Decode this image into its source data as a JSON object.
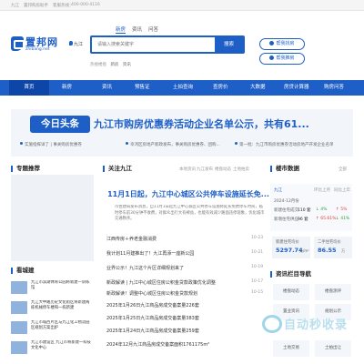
{
  "topbar": {
    "left": "九江",
    "link": "置邦购房助手",
    "phone_label": "客服热线：",
    "phone": "400-000-4116"
  },
  "logo": {
    "cn": "置邦网",
    "en": "zhibang.net"
  },
  "city": "九江",
  "search": {
    "tabs": [
      "新房",
      "资讯",
      "问答"
    ],
    "active_tab": 0,
    "placeholder": "请输入搜索关键字",
    "button": "搜索",
    "hot_label": "热搜楼盘",
    "hot_words": [
      "新房",
      "资讯"
    ]
  },
  "right_buttons": [
    {
      "label": "帮我找房"
    },
    {
      "label": "帮我推房"
    }
  ],
  "nav": [
    "首页",
    "新房",
    "资讯",
    "预售证",
    "土拍查询",
    "查房价",
    "大数据",
    "房贷计算器",
    "购房问答"
  ],
  "banner": {
    "badge": "今日头条",
    "headline": "九江市购房优惠券活动企业名单公示，共有61...",
    "subs": [
      "实施指挥详了 | 事关购房优惠券",
      "幸鸿区房地产新政发布，事关购房优惠券、团购...",
      "第一批：九江市购房优惠券活动房地产开发企业名单"
    ]
  },
  "left": {
    "section_title": "专题推荐",
    "recommend_text": "",
    "section2_title": "看城建",
    "items": [
      "九江市滨湖体育公园将新建一训练馆",
      "九江大中路历史文化街区将新建两栋机械停车楼和一栋新建",
      "九江市城西片区与九江化工物流园区规划方案出炉",
      "九江市建设区 九江市将新建一科技文化中心"
    ]
  },
  "focus": {
    "title": "关注九江",
    "more": "本地资讯",
    "tabs": [
      "九江发布",
      "楼盘动态",
      "土地拍卖"
    ],
    "card_title": "11月1日起，九江中心城区公共停车设施延长免...",
    "card_summary": "市住建局发布消息，自11月1日起九江中心城区公共停车设施将延长免费停车时间，临时停车前30分钟不收费，对群众出行大有裨益，也能有效减少路面违停现象，优化城市交通秩序。",
    "news": [
      {
        "title": "江西传房＋养老金融消费",
        "date": "10-23"
      },
      {
        "title": "我计划11月建推出了！九江再添一座新公园",
        "date": "10-21"
      },
      {
        "title": "业界公示！九江这个片区详细规划来了",
        "date": "10-19"
      },
      {
        "title": "新政解读 | 九江中心城区住房公积金贷款政策优化调整",
        "date": "10-17"
      },
      {
        "title": "新政解读！调整中心城区住房公积金贷款规划",
        "date": "10-15"
      },
      {
        "title": "2025年1月26日九江商品房成交备案量226套",
        "date": ""
      },
      {
        "title": "2025年1月25日九江商品房成交备案量383套",
        "date": ""
      },
      {
        "title": "2025年1月24日九江商品房成交备案量259套",
        "date": ""
      },
      {
        "title": "2024年12月九江商品房成交备案面积1761175m²",
        "date": ""
      }
    ]
  },
  "market": {
    "section_title": "楼市数据",
    "more": "全部",
    "tabs": [
      "九江",
      "环比上月",
      "同比上年"
    ],
    "month": "2024-12月份",
    "rows": [
      {
        "label": "新建住宅成交",
        "value": "110 套",
        "mom": "↓ 4%",
        "yoy": "↑ 5%"
      },
      {
        "label": "新增住宅供应",
        "value": "96 套",
        "mom": "↑ 65.61%",
        "yoy": "↓ 41%"
      }
    ],
    "box1_label": "新建住宅均价",
    "box1_value": "5297.74",
    "box1_unit": "元/m²",
    "box2_label": "二手住宅均价",
    "box2_value": "86.55",
    "box2_unit": "万"
  },
  "guide": {
    "section_title": "资讯栏目导航",
    "items": [
      "楼盘动态",
      "楼盘测评",
      "楼盘测评",
      "置业资讯",
      "规划公示",
      "市场数据",
      "政策解读",
      "购房指南",
      "土地交易",
      "土拍出让"
    ]
  },
  "watermark": "自动秒收录",
  "colors": {
    "brand": "#1e5fc7",
    "nav_active": "#0e46a8"
  }
}
